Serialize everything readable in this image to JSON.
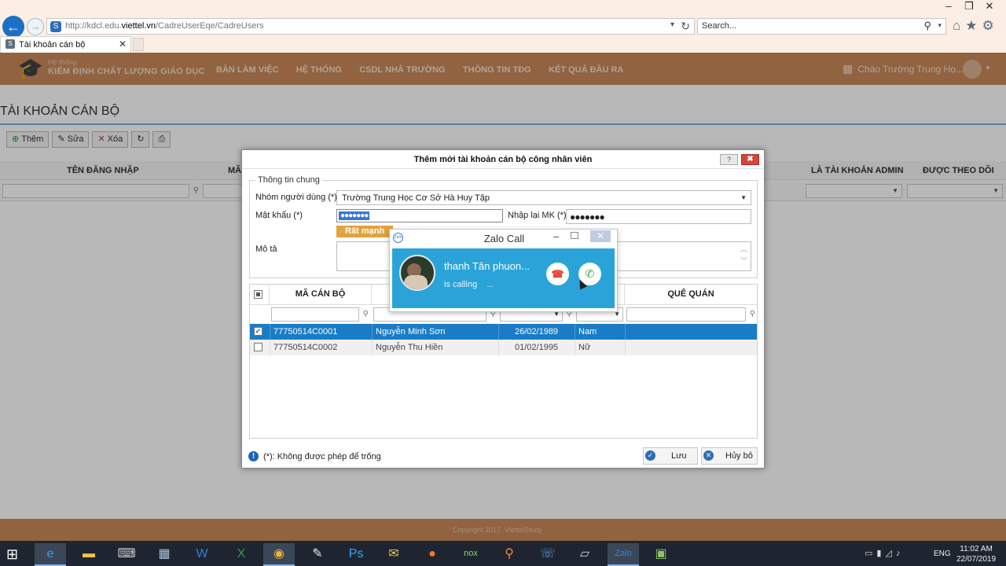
{
  "browser": {
    "url_prefix": "http://kdcl.edu.",
    "url_domain": "viettel.vn",
    "url_path": "/CadreUserEqe/CadreUsers",
    "search_placeholder": "Search...",
    "tab_title": "Tài khoản cán bộ"
  },
  "app": {
    "logo_small": "Hệ thống",
    "logo_big": "KIỂM ĐỊNH CHẤT LƯỢNG GIÁO DỤC",
    "menu": [
      "BÀN LÀM VIỆC",
      "HỆ THỐNG",
      "CSDL NHÀ TRƯỜNG",
      "THÔNG TIN TĐG",
      "KẾT QUẢ ĐẦU RA"
    ],
    "greeting": "Chào Trường Trung Họ...!",
    "copyright": "Copyright 2017, ViettelStudy"
  },
  "page": {
    "title": "TÀI KHOẢN CÁN BỘ",
    "toolbar": {
      "add": "Thêm",
      "edit": "Sửa",
      "delete": "Xóa"
    },
    "columns": {
      "username": "TÊN ĐĂNG NHẬP",
      "code_short": "MÃ",
      "admin": "LÀ TÀI KHOẢN ADMIN",
      "followed": "ĐƯỢC THEO DÕI"
    }
  },
  "modal": {
    "title": "Thêm mới tài khoản cán bộ công nhân viên",
    "help": "?",
    "close": "✖",
    "section_legend": "Thông tin chung",
    "group_label": "Nhóm người dùng (*)",
    "group_value": "Trường Trung Học Cơ Sở Hà Huy Tập",
    "password_label": "Mật khẩu (*)",
    "password_value": "●●●●●●●",
    "confirm_label": "Nhập lại MK (*)",
    "confirm_value": "●●●●●●●",
    "strength": "Rất mạnh",
    "description_label": "Mô tả",
    "table": {
      "headers": {
        "code": "MÃ CÁN BỘ",
        "hometown": "QUÊ QUÁN"
      },
      "rows": [
        {
          "checked": true,
          "code": "77750514C0001",
          "name": "Nguyễn Minh Sơn",
          "dob": "26/02/1989",
          "gender": "Nam"
        },
        {
          "checked": false,
          "code": "77750514C0002",
          "name": "Nguyễn Thu Hiền",
          "dob": "01/02/1995",
          "gender": "Nữ"
        }
      ]
    },
    "footnote": "(*): Không được phép để trống",
    "save": "Lưu",
    "cancel": "Hủy bỏ"
  },
  "zalo": {
    "title": "Zalo Call",
    "caller": "thanh Tân phuon...",
    "status": "is calling",
    "status_dots": "..."
  },
  "taskbar": {
    "lang": "ENG",
    "time": "11:02 AM",
    "date": "22/07/2019"
  },
  "colors": {
    "header_bg": "#c9895a",
    "accent_blue": "#1a7cc7",
    "zalo_blue": "#2aa4d8",
    "strength_orange": "#e2a23d"
  }
}
